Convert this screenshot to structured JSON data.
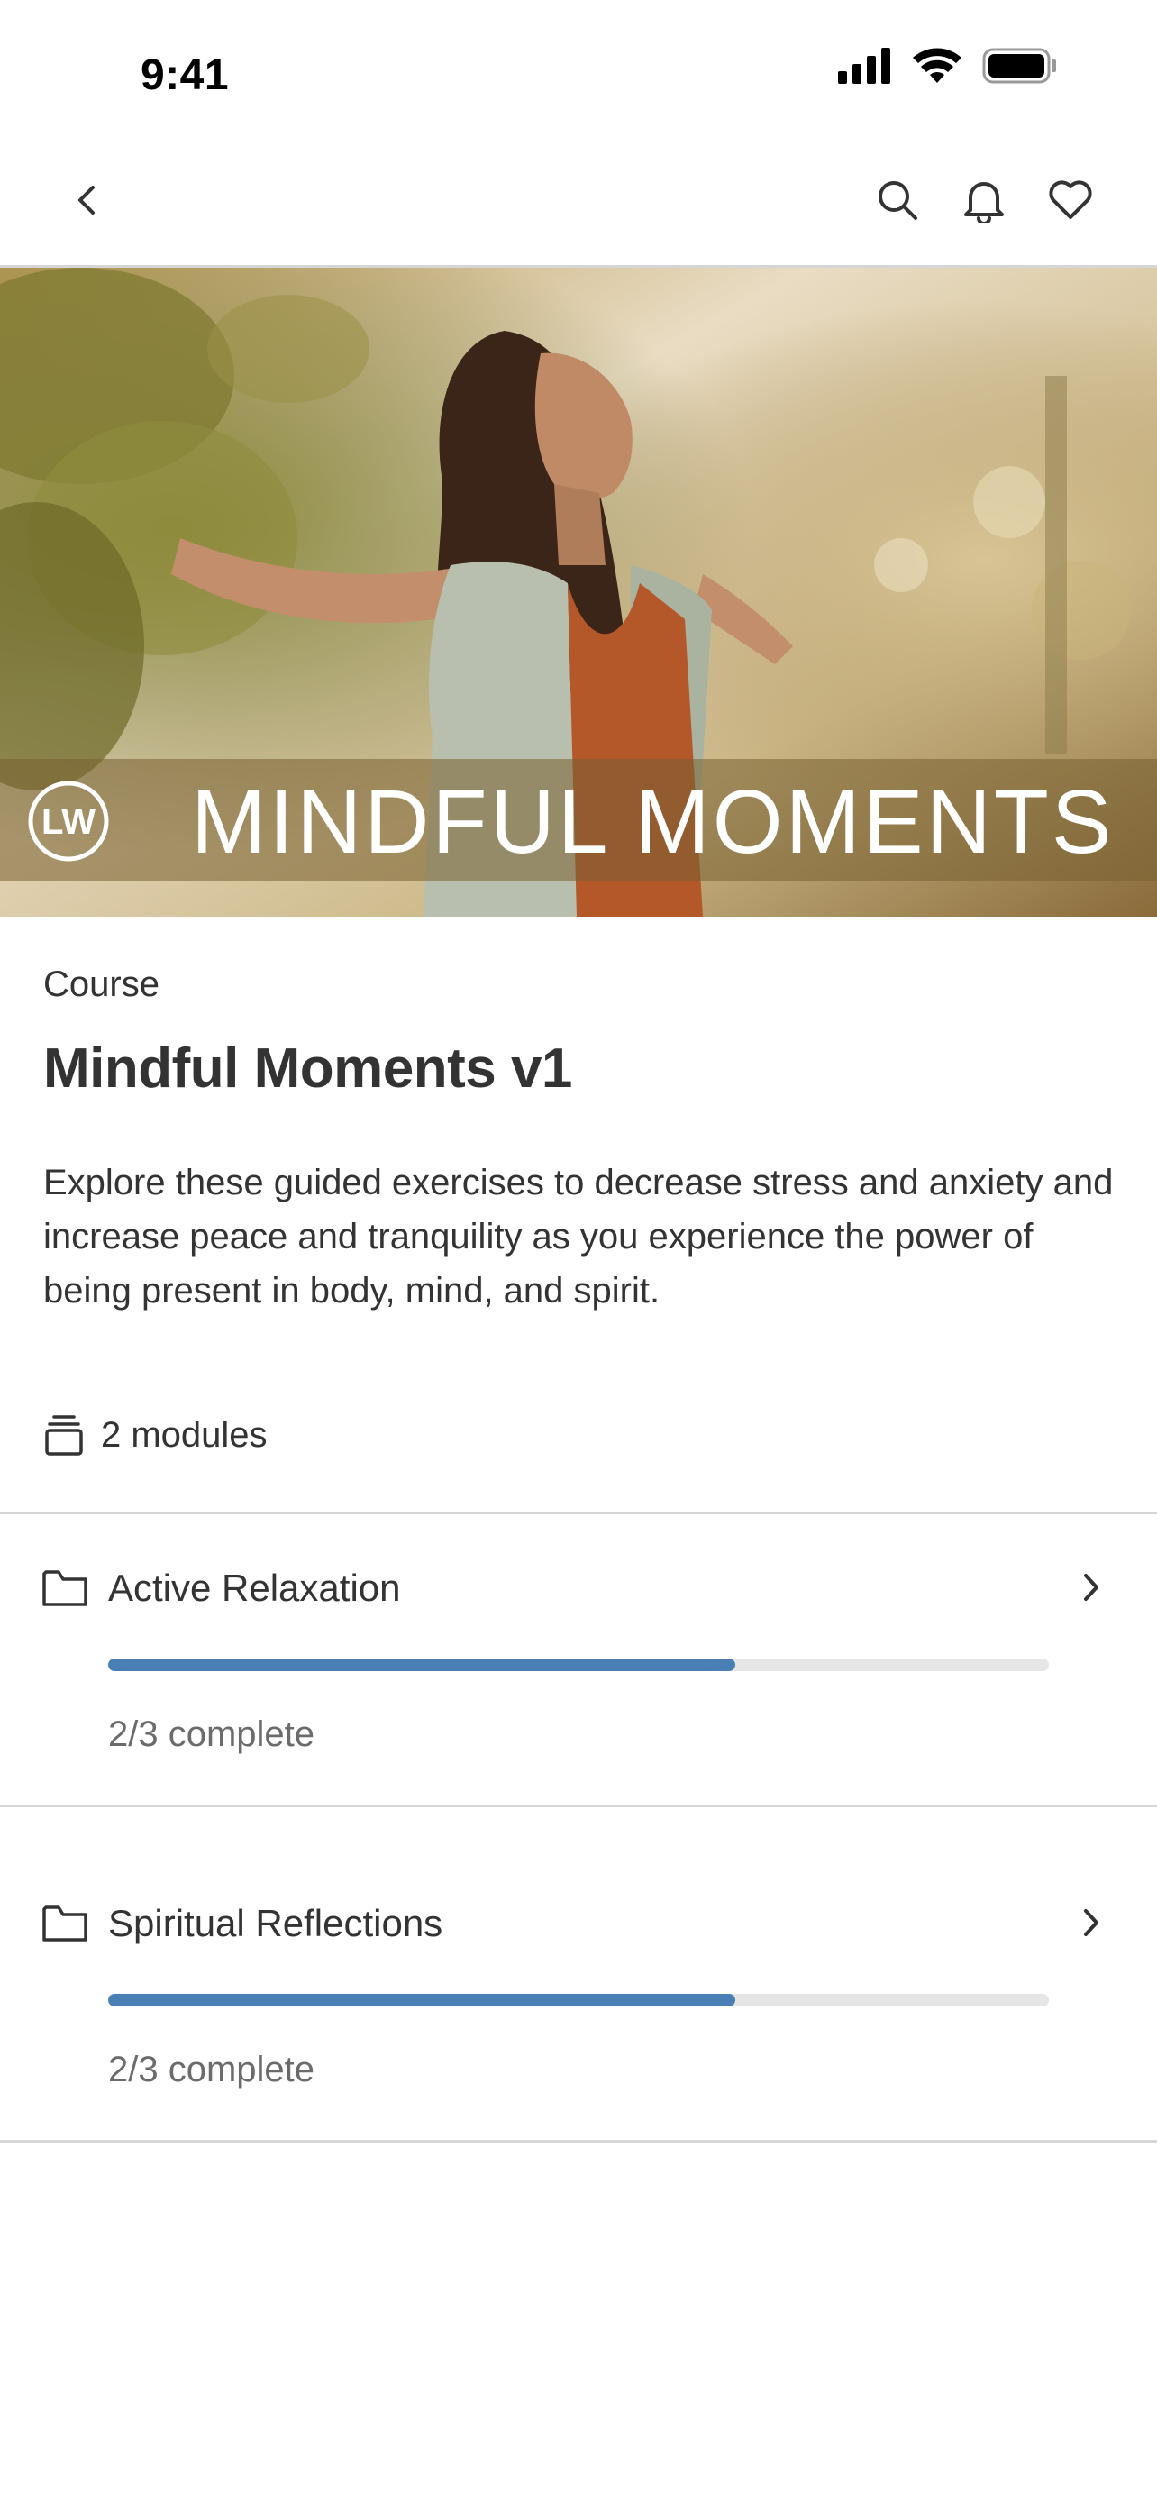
{
  "status_bar": {
    "time": "9:41"
  },
  "hero": {
    "brand": "LW",
    "banner_title": "MINDFUL MOMENTS"
  },
  "course": {
    "type_label": "Course",
    "title": "Mindful Moments v1",
    "description": "Explore these guided exercises to decrease stress and anxiety and increase peace and tranquility as you experience the power of being present in body, mind, and spirit.",
    "modules_count_label": "2 modules"
  },
  "modules": [
    {
      "name": "Active Relaxation",
      "progress_fraction": 0.667,
      "status": "2/3 complete"
    },
    {
      "name": "Spiritual Reflections",
      "progress_fraction": 0.667,
      "status": "2/3 complete"
    }
  ],
  "colors": {
    "progress": "#4a7fb5",
    "progress_track": "#e6e6e6",
    "text": "#333333",
    "muted": "#6b6b6b"
  },
  "icons": [
    "signal-icon",
    "wifi-icon",
    "battery-icon",
    "back-icon",
    "search-icon",
    "bell-icon",
    "heart-icon",
    "modules-icon",
    "folder-icon",
    "chevron-right-icon"
  ]
}
